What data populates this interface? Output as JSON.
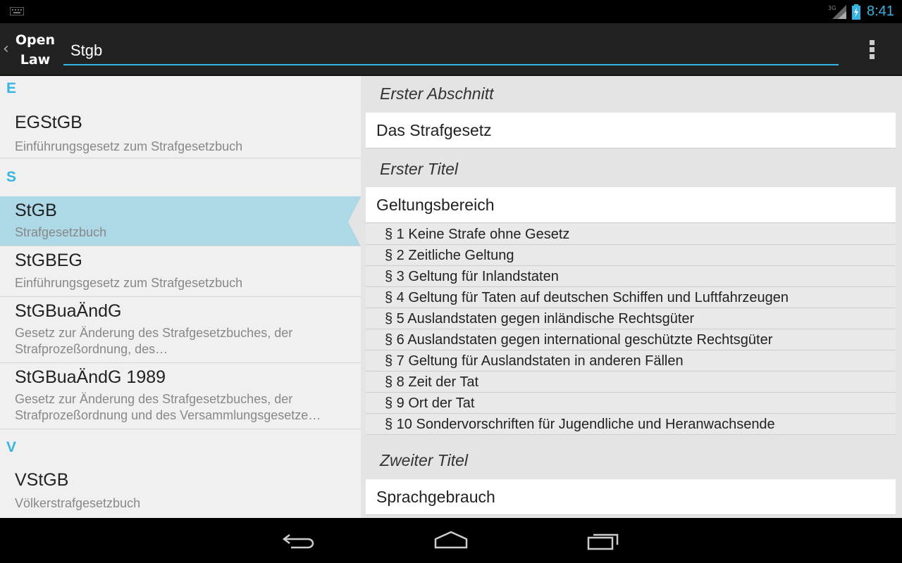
{
  "status_bar": {
    "network": "3G",
    "time": "8:41"
  },
  "action_bar": {
    "logo_line1": "Open",
    "logo_line2": "Law",
    "search_value": "Stgb"
  },
  "law_list": {
    "sections": [
      {
        "letter": "E",
        "items": [
          {
            "title": "EGStGB",
            "subtitle": "Einführungsgesetz zum Strafgesetzbuch"
          }
        ]
      },
      {
        "letter": "S",
        "items": [
          {
            "title": "StGB",
            "subtitle": "Strafgesetzbuch",
            "selected": true
          },
          {
            "title": "StGBEG",
            "subtitle": "Einführungsgesetz zum Strafgesetzbuch"
          },
          {
            "title": "StGBuaÄndG",
            "subtitle_line1": "Gesetz zur Änderung des Strafgesetzbuches, der",
            "subtitle_line2": "Strafprozeßordnung, des…"
          },
          {
            "title": "StGBuaÄndG 1989",
            "subtitle_line1": "Gesetz zur Änderung des Strafgesetzbuches, der",
            "subtitle_line2": "Strafprozeßordnung und des Versammlungsgesetze…"
          }
        ]
      },
      {
        "letter": "V",
        "items": [
          {
            "title": "VStGB",
            "subtitle": "Völkerstrafgesetzbuch"
          }
        ]
      }
    ]
  },
  "toc": {
    "abschnitt_label": "Erster Abschnitt",
    "abschnitt_title": "Das Strafgesetz",
    "titel1_label": "Erster Titel",
    "titel1_title": "Geltungsbereich",
    "paragraphs": [
      "§ 1 Keine Strafe ohne Gesetz",
      "§ 2 Zeitliche Geltung",
      "§ 3 Geltung für Inlandstaten",
      "§ 4 Geltung für Taten auf deutschen Schiffen und Luftfahrzeugen",
      "§ 5 Auslandstaten gegen inländische Rechtsgüter",
      "§ 6 Auslandstaten gegen international geschützte Rechtsgüter",
      "§ 7 Geltung für Auslandstaten in anderen Fällen",
      "§ 8 Zeit der Tat",
      "§ 9 Ort der Tat",
      "§ 10 Sondervorschriften für Jugendliche und Heranwachsende"
    ],
    "titel2_label": "Zweiter Titel",
    "titel2_title": "Sprachgebrauch"
  },
  "colors": {
    "accent": "#33b5e5",
    "selected": "#add8e6"
  }
}
